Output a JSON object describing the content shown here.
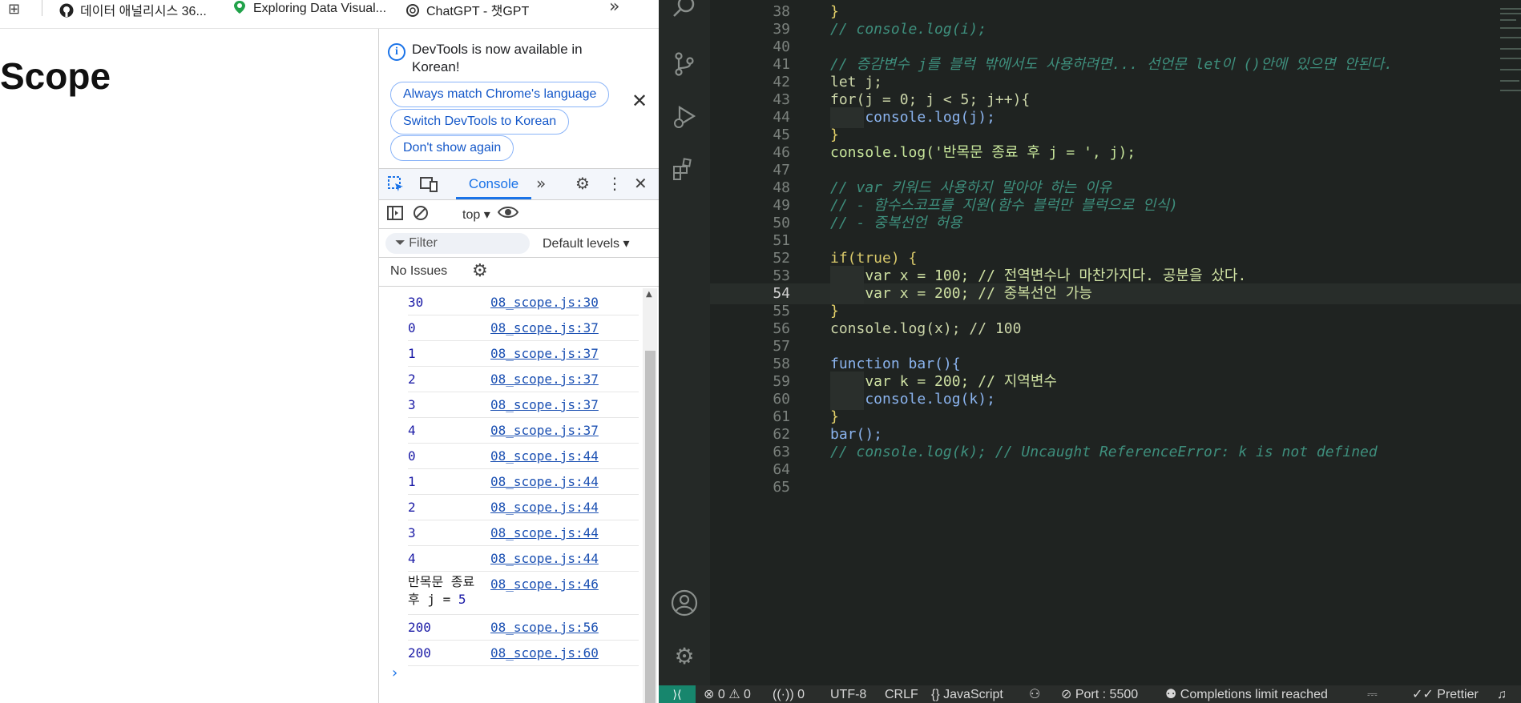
{
  "browser": {
    "bookmarks": [
      {
        "label": "데이터 애널리시스 36...",
        "icon": "github-icon"
      },
      {
        "label": "Exploring Data Visual...",
        "icon": "location-pin-icon"
      },
      {
        "label": "ChatGPT - 챗GPT",
        "icon": "openai-icon"
      }
    ],
    "page_title": "Scope"
  },
  "devtools": {
    "notice": {
      "text": "DevTools is now available in Korean!",
      "buttons": [
        "Always match Chrome's language",
        "Switch DevTools to Korean",
        "Don't show again"
      ]
    },
    "active_tab": "Console",
    "context": "top",
    "filter_placeholder": "Filter",
    "levels": "Default levels",
    "issues": "No Issues",
    "logs": [
      {
        "value": "30",
        "source": "08_scope.js:30"
      },
      {
        "value": "0",
        "source": "08_scope.js:37"
      },
      {
        "value": "1",
        "source": "08_scope.js:37"
      },
      {
        "value": "2",
        "source": "08_scope.js:37"
      },
      {
        "value": "3",
        "source": "08_scope.js:37"
      },
      {
        "value": "4",
        "source": "08_scope.js:37"
      },
      {
        "value": "0",
        "source": "08_scope.js:44"
      },
      {
        "value": "1",
        "source": "08_scope.js:44"
      },
      {
        "value": "2",
        "source": "08_scope.js:44"
      },
      {
        "value": "3",
        "source": "08_scope.js:44"
      },
      {
        "value": "4",
        "source": "08_scope.js:44"
      }
    ],
    "log_text_row": {
      "text_line1": "반목문 종료",
      "text_line2": "후 j = ",
      "number": "5",
      "source": "08_scope.js:46"
    },
    "logs_after": [
      {
        "value": "200",
        "source": "08_scope.js:56"
      },
      {
        "value": "200",
        "source": "08_scope.js:60"
      }
    ]
  },
  "editor": {
    "active_line": 54,
    "lines": [
      {
        "n": "38",
        "code": "}"
      },
      {
        "n": "39",
        "code": "// console.log(i);"
      },
      {
        "n": "40",
        "code": ""
      },
      {
        "n": "41",
        "code": "// 증감변수 j를 블럭 밖에서도 사용하려면... 선언문 let이 ()안에 있으면 안된다."
      },
      {
        "n": "42",
        "code": "let j;"
      },
      {
        "n": "43",
        "code": "for(j = 0; j < 5; j++){"
      },
      {
        "n": "44",
        "code": "    console.log(j);"
      },
      {
        "n": "45",
        "code": "}"
      },
      {
        "n": "46",
        "code": "console.log('반목문 종료 후 j = ', j);"
      },
      {
        "n": "47",
        "code": ""
      },
      {
        "n": "48",
        "code": "// var 키워드 사용하지 말아야 하는 이유"
      },
      {
        "n": "49",
        "code": "// - 함수스코프를 지원(함수 블럭만 블럭으로 인식)"
      },
      {
        "n": "50",
        "code": "// - 중복선언 허용"
      },
      {
        "n": "51",
        "code": ""
      },
      {
        "n": "52",
        "code": "if(true) {"
      },
      {
        "n": "53",
        "code": "    var x = 100; // 전역변수나 마찬가지다. 공분을 샀다."
      },
      {
        "n": "54",
        "code": "    var x = 200; // 중복선언 가능"
      },
      {
        "n": "55",
        "code": "}"
      },
      {
        "n": "56",
        "code": "console.log(x); // 100"
      },
      {
        "n": "57",
        "code": ""
      },
      {
        "n": "58",
        "code": "function bar(){"
      },
      {
        "n": "59",
        "code": "    var k = 200; // 지역변수"
      },
      {
        "n": "60",
        "code": "    console.log(k);"
      },
      {
        "n": "61",
        "code": "}"
      },
      {
        "n": "62",
        "code": "bar();"
      },
      {
        "n": "63",
        "code": "// console.log(k); // Uncaught ReferenceError: k is not defined"
      },
      {
        "n": "64",
        "code": ""
      },
      {
        "n": "65",
        "code": ""
      }
    ]
  },
  "statusbar": {
    "errors": "0",
    "warnings": "0",
    "ports": "0",
    "encoding": "UTF-8",
    "eol": "CRLF",
    "language": "JavaScript",
    "port": "Port : 5500",
    "completions": "Completions limit reached",
    "prettier": "Prettier"
  }
}
